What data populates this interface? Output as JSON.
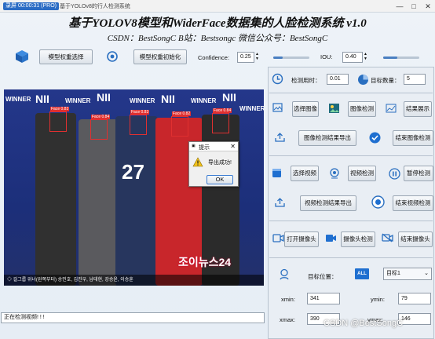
{
  "window": {
    "badge": "录屏 00:00:31 (PRO)",
    "title": "基于YOLOv8的行人检测系统",
    "minimize": "—",
    "maximize": "□",
    "close": "✕"
  },
  "header": {
    "title": "基于YOLOV8模型和WiderFace数据集的人脸检测系统 v1.0",
    "subtitle": "CSDN：BestSongC   B站：Bestsongc   微信公众号：BestSongC"
  },
  "toolbar": {
    "select_model": "模型权重选择",
    "init_model": "模型权重初始化",
    "confidence_label": "Confidence:",
    "confidence_value": "0.25",
    "iou_label": "IOU:",
    "iou_value": "0.40",
    "confidence_level": 0.25,
    "iou_level": 0.4
  },
  "stats": {
    "time_label": "检测用时：",
    "time_value": "0.01",
    "count_label": "目标数量：",
    "count_value": "5"
  },
  "image_section": {
    "select": "选择图像",
    "detect": "图像检测",
    "show": "结果展示",
    "export": "图像检测结果导出",
    "end": "结束图像检测"
  },
  "video_section": {
    "select": "选择视频",
    "detect": "视频检测",
    "pause": "暂停检测",
    "export": "视频检测结果导出",
    "end": "结束视频检测"
  },
  "camera_section": {
    "open": "打开摄像头",
    "detect": "摄像头检测",
    "end": "结束摄像头"
  },
  "target": {
    "label": "目标位置：",
    "all_icon": "ALL",
    "selected": "目标1",
    "xmin_label": "xmin:",
    "xmin": "341",
    "ymin_label": "ymin:",
    "ymin": "79",
    "xmax_label": "xmax:",
    "xmax": "390",
    "ymax_label": "ymax:",
    "ymax": "146"
  },
  "scene": {
    "faces": [
      "Face 0.83",
      "Face 0.84",
      "Face 0.83",
      "Face 0.82",
      "Face 0.84"
    ],
    "wall_words": [
      "WINNER",
      "NII",
      "WINNER",
      "NII",
      "WINNER",
      "NII",
      "WINNER",
      "NII",
      "WINNER"
    ],
    "logo": "조이뉴스24",
    "caption": "◇ 걸그룹 위너(왼쪽부터)  송민호, 김진우, 남태현, 강승윤, 이승훈"
  },
  "dialog": {
    "title": "提示",
    "message": "导出成功!",
    "ok": "OK",
    "close": "✕"
  },
  "status": {
    "text": "正在检测视频! ! !"
  },
  "watermark": "CSDN @BestSongC"
}
